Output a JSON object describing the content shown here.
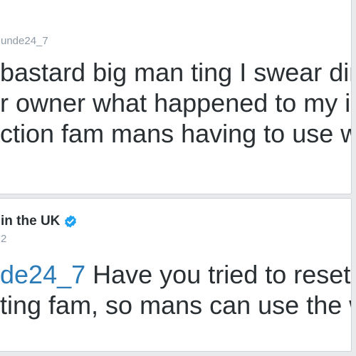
{
  "colors": {
    "background": "#e9eaec",
    "card": "#ffffff",
    "text": "#292f33",
    "muted": "#8f9aa5",
    "link": "#2b7bb9",
    "verified": "#1da1f2"
  },
  "tweet1": {
    "handle": "unde24_7",
    "lines": [
      "bastard big man ting I swear dire",
      "r owner what happened to my in",
      "ction fam mans having to use w"
    ]
  },
  "tweet2": {
    "account_name": "in the UK",
    "verified_icon": "verified-badge-icon",
    "date": "2",
    "line1_mention": "de24_7",
    "line1_rest": " Have you tried to reset th",
    "line2": "ting fam, so mans can use the w"
  }
}
